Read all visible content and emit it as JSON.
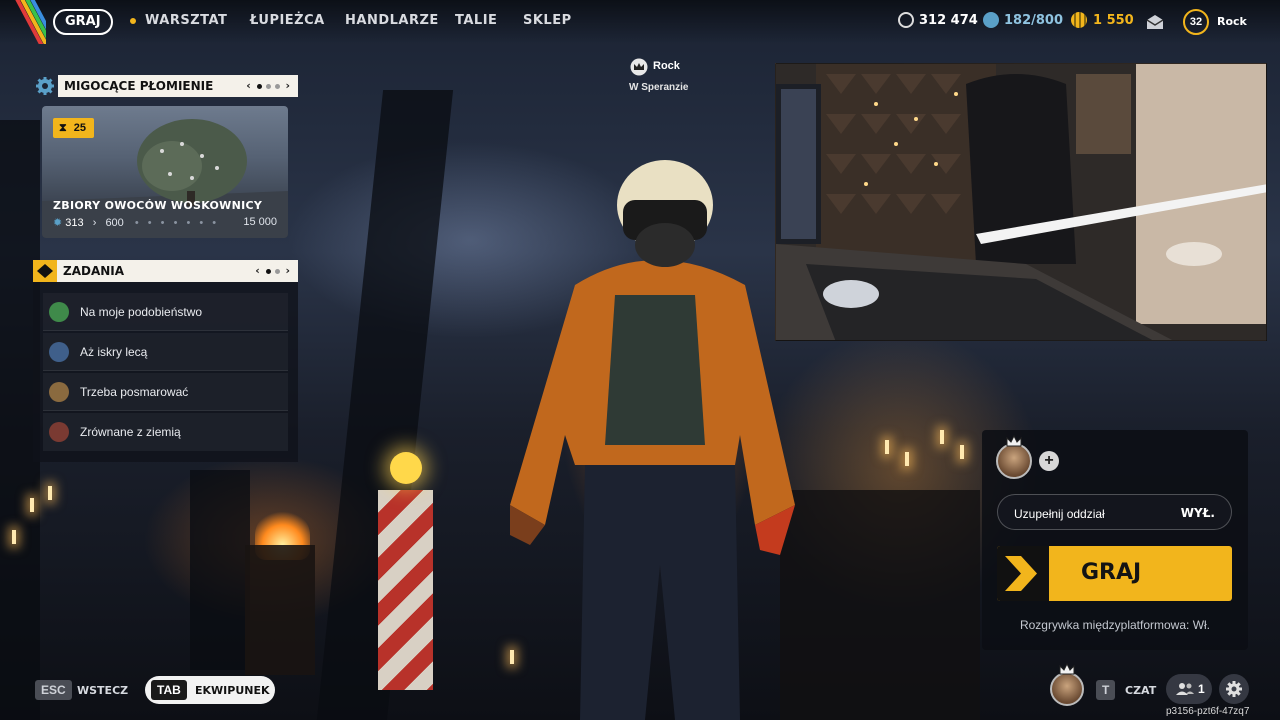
{
  "nav": {
    "active": "GRAJ",
    "items": [
      "WARSZTAT",
      "ŁUPIEŻCA",
      "HANDLARZE",
      "TALIE",
      "SKLEP"
    ]
  },
  "currencies": [
    {
      "value": "312 474",
      "icon": "credits-icon"
    },
    {
      "value": "182/800",
      "icon": "coin-icon"
    },
    {
      "value": "1 550",
      "icon": "premium-currency-icon"
    }
  ],
  "profile": {
    "level": "32",
    "name": "Rock"
  },
  "status": {
    "name": "Rock",
    "location": "W Speranzie"
  },
  "event": {
    "title": "MIGOCĄCE PŁOMIENIE",
    "badge": "25",
    "card_title": "ZBIORY OWOCÓW WOSKOWNICY",
    "current": "313",
    "next": "600",
    "max": "15 000"
  },
  "tasks": {
    "title": "ZADANIA",
    "items": [
      {
        "label": "Na moje podobieństwo",
        "color": "#3f8a4a"
      },
      {
        "label": "Aż iskry lecą",
        "color": "#3f5f8a"
      },
      {
        "label": "Trzeba posmarować",
        "color": "#8a6a3f"
      },
      {
        "label": "Zrównane z ziemią",
        "color": "#7a3a32"
      }
    ]
  },
  "squad": {
    "label": "Uzupełnij oddział",
    "value": "WYŁ."
  },
  "play": {
    "label": "GRAJ"
  },
  "crossplay": "Rozgrywka międzyplatformowa: Wł.",
  "bottom": {
    "esc_key": "ESC",
    "esc_label": "WSTECZ",
    "tab_key": "TAB",
    "tab_label": "EKWIPUNEK",
    "t_key": "T",
    "chat_label": "CZAT",
    "party_count": "1",
    "session_id": "p3156-pzt6f-47zq7"
  },
  "colors": {
    "accent": "#f2b51c",
    "panel_header": "#f4f1ea"
  }
}
